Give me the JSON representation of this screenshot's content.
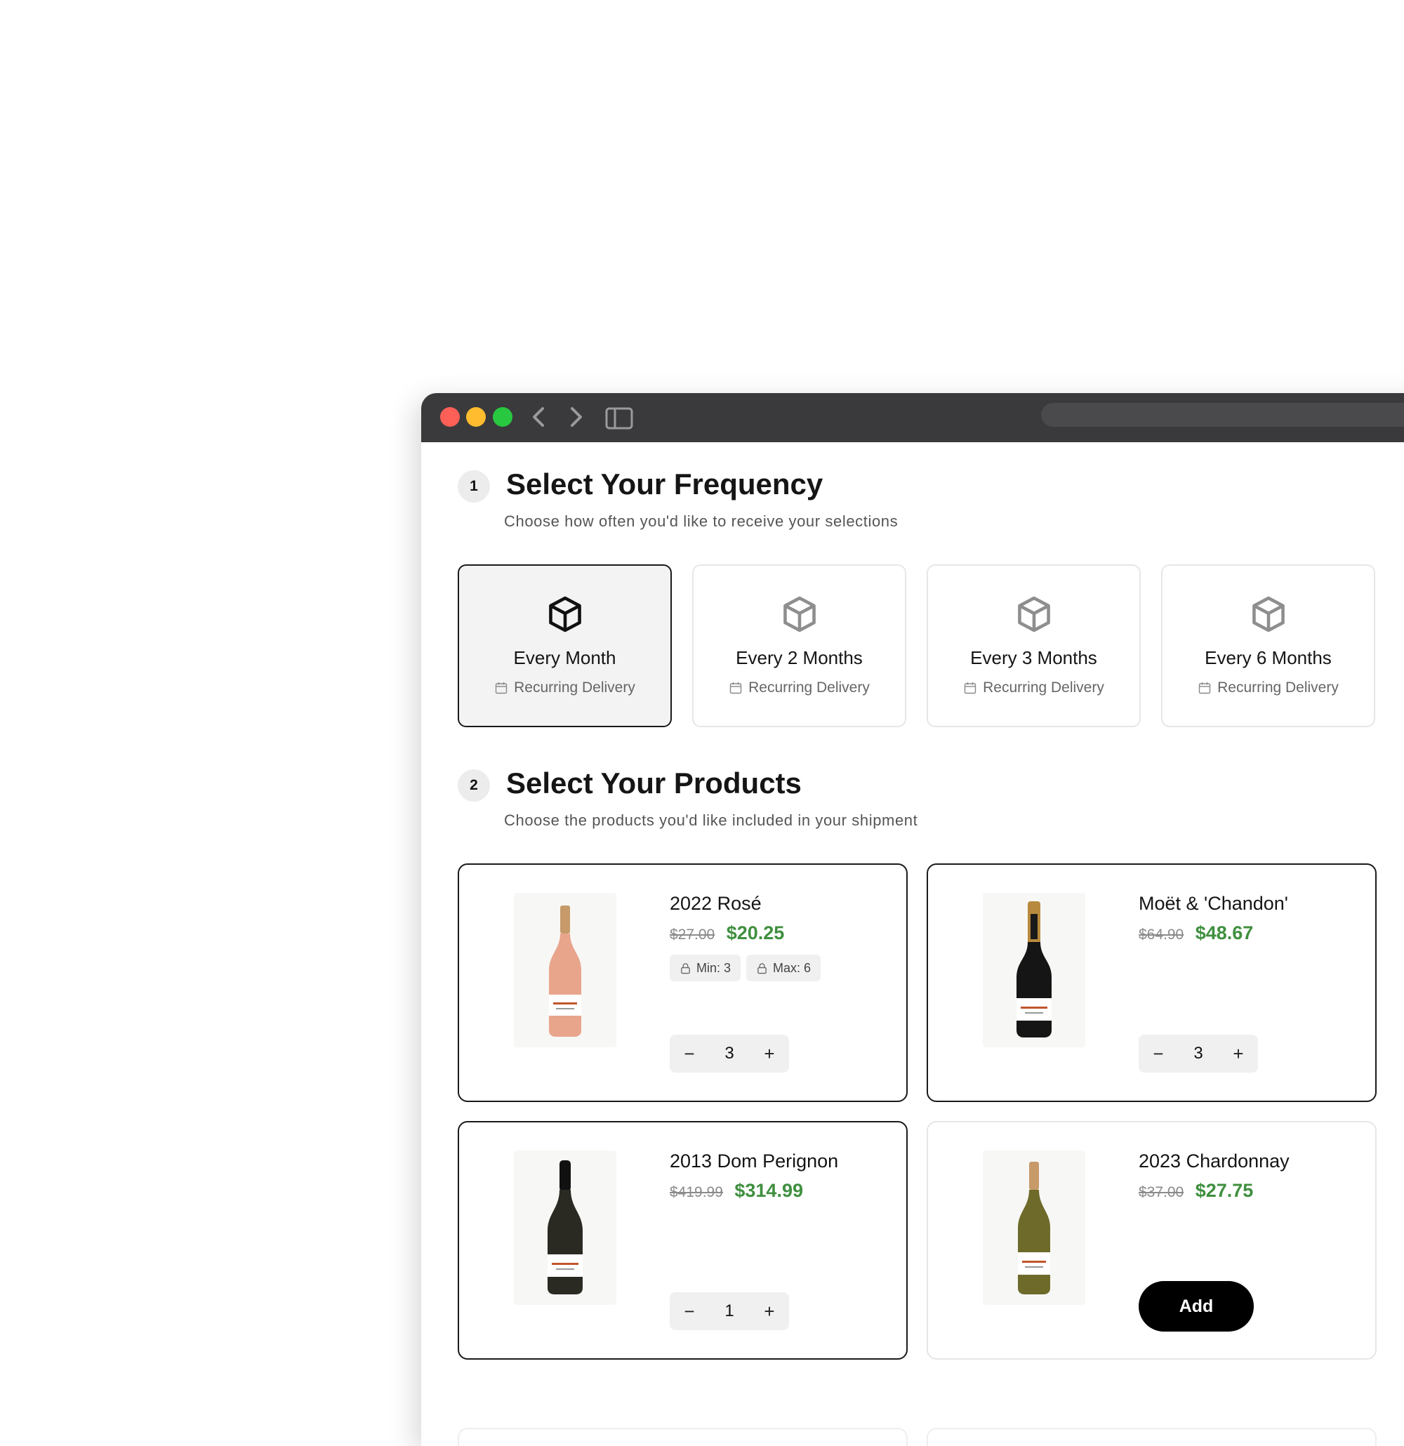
{
  "steps": [
    {
      "number": "1",
      "title": "Select Your Frequency",
      "subtitle": "Choose how often you'd like to receive your selections"
    },
    {
      "number": "2",
      "title": "Select Your Products",
      "subtitle": "Choose the products you'd like included in your shipment"
    }
  ],
  "frequency_options": [
    {
      "label": "Every Month",
      "sub": "Recurring Delivery",
      "selected": true
    },
    {
      "label": "Every 2 Months",
      "sub": "Recurring Delivery",
      "selected": false
    },
    {
      "label": "Every 3 Months",
      "sub": "Recurring Delivery",
      "selected": false
    },
    {
      "label": "Every 6 Months",
      "sub": "Recurring Delivery",
      "selected": false
    }
  ],
  "products": [
    {
      "name": "2022 Rosé",
      "old_price": "$27.00",
      "price": "$20.25",
      "min": "Min: 3",
      "max": "Max: 6",
      "qty": "3",
      "selected": true
    },
    {
      "name": "Moët & 'Chandon'",
      "old_price": "$64.90",
      "price": "$48.67",
      "qty": "3",
      "selected": true
    },
    {
      "name": "2013 Dom Perignon",
      "old_price": "$419.99",
      "price": "$314.99",
      "qty": "1",
      "selected": true
    },
    {
      "name": "2023 Chardonnay",
      "old_price": "$37.00",
      "price": "$27.75",
      "add_label": "Add",
      "selected": false
    }
  ],
  "stepper": {
    "minus": "−",
    "plus": "+"
  },
  "colors": {
    "titlebar": "#3a3a3c",
    "accent_price": "#3f8f3f",
    "selected_border": "#1a1a1a",
    "add_button": "#000000"
  },
  "icons": {
    "frequency": "box-icon",
    "recurring": "calendar-icon",
    "limit": "lock-icon"
  }
}
